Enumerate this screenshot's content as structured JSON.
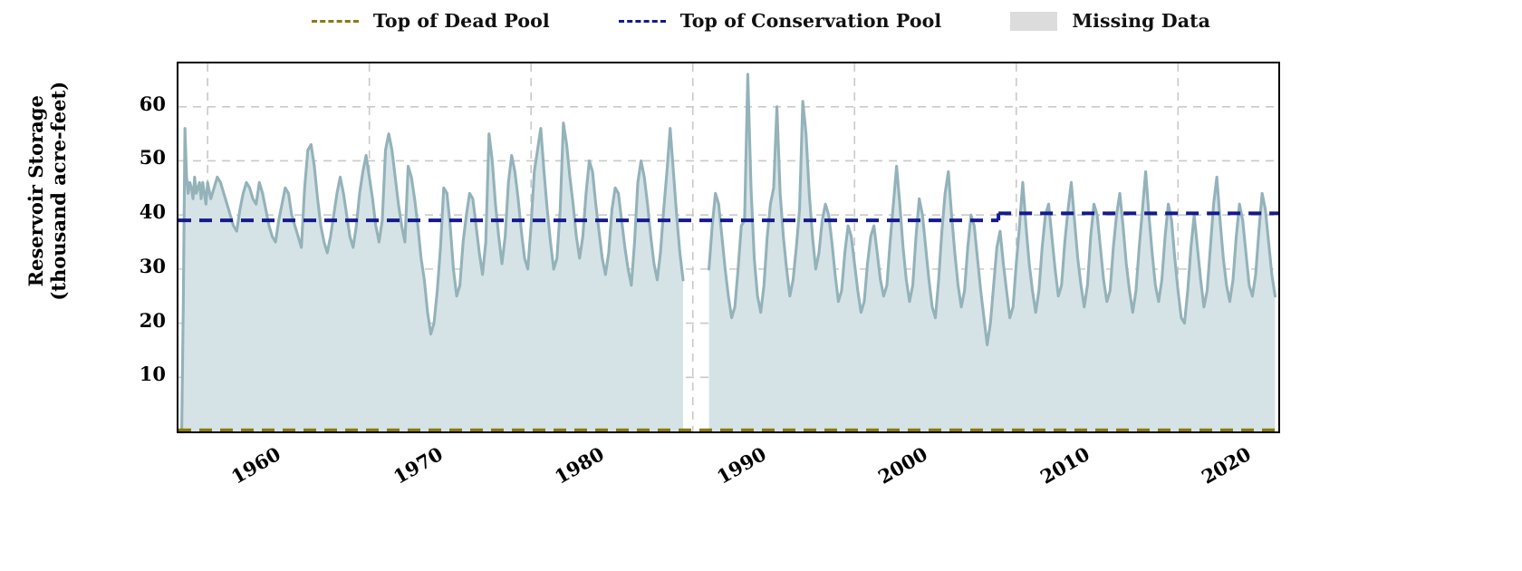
{
  "legend": {
    "entries": [
      {
        "label": "Top of Dead Pool",
        "style": "dashed",
        "color": "#8a7a10"
      },
      {
        "label": "Top of Conservation Pool",
        "style": "dashed",
        "color": "#151a8c"
      },
      {
        "label": "Missing Data",
        "style": "patch",
        "color": "#dcdcdc"
      }
    ]
  },
  "chart_data": {
    "type": "area",
    "title": "",
    "xlabel": "",
    "ylabel": "Reservoir Storage\n(thousand acre-feet)",
    "ylabel_line1": "Reservoir Storage",
    "ylabel_line2": "(thousand acre-feet)",
    "xlim": [
      1958.2,
      2026.2
    ],
    "ylim": [
      0,
      68
    ],
    "yticks": [
      10,
      20,
      30,
      40,
      50,
      60
    ],
    "xticks": [
      1960,
      1970,
      1980,
      1990,
      2000,
      2010,
      2020
    ],
    "grid": true,
    "legend_position": "above-plot-center",
    "colors": {
      "line": "#93b2ba",
      "fill": "#d6e3e6",
      "dead_pool": "#8a7a10",
      "conservation_pool": "#151a8c",
      "missing_data": "#dcdcdc",
      "grid": "#c9c9c9",
      "axis": "#000000"
    },
    "series": [
      {
        "name": "Reservoir Storage",
        "type": "area",
        "units": "thousand acre-feet",
        "x": [
          1958.4,
          1958.5,
          1958.6,
          1958.7,
          1958.8,
          1958.9,
          1959.0,
          1959.1,
          1959.2,
          1959.3,
          1959.4,
          1959.5,
          1959.6,
          1959.7,
          1959.8,
          1959.9,
          1960.0,
          1960.2,
          1960.4,
          1960.6,
          1960.8,
          1961.0,
          1961.2,
          1961.4,
          1961.6,
          1961.8,
          1962.0,
          1962.2,
          1962.4,
          1962.6,
          1962.8,
          1963.0,
          1963.2,
          1963.4,
          1963.6,
          1963.8,
          1964.0,
          1964.2,
          1964.4,
          1964.6,
          1964.8,
          1965.0,
          1965.2,
          1965.4,
          1965.6,
          1965.8,
          1966.0,
          1966.2,
          1966.4,
          1966.6,
          1966.8,
          1967.0,
          1967.2,
          1967.4,
          1967.6,
          1967.8,
          1968.0,
          1968.2,
          1968.4,
          1968.6,
          1968.8,
          1969.0,
          1969.2,
          1969.4,
          1969.6,
          1969.8,
          1970.0,
          1970.2,
          1970.4,
          1970.6,
          1970.8,
          1971.0,
          1971.2,
          1971.4,
          1971.6,
          1971.8,
          1972.0,
          1972.2,
          1972.4,
          1972.6,
          1972.8,
          1973.0,
          1973.2,
          1973.4,
          1973.6,
          1973.8,
          1974.0,
          1974.2,
          1974.4,
          1974.6,
          1974.8,
          1975.0,
          1975.2,
          1975.4,
          1975.6,
          1975.8,
          1976.0,
          1976.2,
          1976.4,
          1976.6,
          1976.8,
          1977.0,
          1977.2,
          1977.4,
          1977.6,
          1977.8,
          1978.0,
          1978.2,
          1978.4,
          1978.6,
          1978.8,
          1979.0,
          1979.2,
          1979.4,
          1979.6,
          1979.8,
          1980.0,
          1980.2,
          1980.4,
          1980.6,
          1980.8,
          1981.0,
          1981.2,
          1981.4,
          1981.6,
          1981.8,
          1982.0,
          1982.2,
          1982.4,
          1982.6,
          1982.8,
          1983.0,
          1983.2,
          1983.4,
          1983.6,
          1983.8,
          1984.0,
          1984.2,
          1984.4,
          1984.6,
          1984.8,
          1985.0,
          1985.2,
          1985.4,
          1985.6,
          1985.8,
          1986.0,
          1986.2,
          1986.4,
          1986.6,
          1986.8,
          1987.0,
          1987.2,
          1987.4,
          1987.6,
          1987.8,
          1988.0,
          1988.2,
          1988.4,
          1988.6,
          1988.8,
          1989.0,
          1989.2,
          1989.4,
          1991.0,
          1991.2,
          1991.4,
          1991.6,
          1991.8,
          1992.0,
          1992.2,
          1992.4,
          1992.6,
          1992.8,
          1993.0,
          1993.2,
          1993.4,
          1993.6,
          1993.8,
          1994.0,
          1994.2,
          1994.4,
          1994.6,
          1994.8,
          1995.0,
          1995.2,
          1995.4,
          1995.6,
          1995.8,
          1996.0,
          1996.2,
          1996.4,
          1996.6,
          1996.8,
          1997.0,
          1997.2,
          1997.4,
          1997.6,
          1997.8,
          1998.0,
          1998.2,
          1998.4,
          1998.6,
          1998.8,
          1999.0,
          1999.2,
          1999.4,
          1999.6,
          1999.8,
          2000.0,
          2000.2,
          2000.4,
          2000.6,
          2000.8,
          2001.0,
          2001.2,
          2001.4,
          2001.6,
          2001.8,
          2002.0,
          2002.2,
          2002.4,
          2002.6,
          2002.8,
          2003.0,
          2003.2,
          2003.4,
          2003.6,
          2003.8,
          2004.0,
          2004.2,
          2004.4,
          2004.6,
          2004.8,
          2005.0,
          2005.2,
          2005.4,
          2005.6,
          2005.8,
          2006.0,
          2006.2,
          2006.4,
          2006.6,
          2006.8,
          2007.0,
          2007.2,
          2007.4,
          2007.6,
          2007.8,
          2008.0,
          2008.2,
          2008.4,
          2008.6,
          2008.8,
          2009.0,
          2009.2,
          2009.4,
          2009.6,
          2009.8,
          2010.0,
          2010.2,
          2010.4,
          2010.6,
          2010.8,
          2011.0,
          2011.2,
          2011.4,
          2011.6,
          2011.8,
          2012.0,
          2012.2,
          2012.4,
          2012.6,
          2012.8,
          2013.0,
          2013.2,
          2013.4,
          2013.6,
          2013.8,
          2014.0,
          2014.2,
          2014.4,
          2014.6,
          2014.8,
          2015.0,
          2015.2,
          2015.4,
          2015.6,
          2015.8,
          2016.0,
          2016.2,
          2016.4,
          2016.6,
          2016.8,
          2017.0,
          2017.2,
          2017.4,
          2017.6,
          2017.8,
          2018.0,
          2018.2,
          2018.4,
          2018.6,
          2018.8,
          2019.0,
          2019.2,
          2019.4,
          2019.6,
          2019.8,
          2020.0,
          2020.2,
          2020.4,
          2020.6,
          2020.8,
          2021.0,
          2021.2,
          2021.4,
          2021.6,
          2021.8,
          2022.0,
          2022.2,
          2022.4,
          2022.6,
          2022.8,
          2023.0,
          2023.2,
          2023.4,
          2023.6,
          2023.8,
          2024.0,
          2024.2,
          2024.4,
          2024.6,
          2024.8,
          2025.0,
          2025.2,
          2025.4,
          2025.6,
          2025.8,
          2026.0
        ],
        "y": [
          0,
          24,
          56,
          47,
          44,
          46,
          45,
          43,
          47,
          44,
          45,
          46,
          43,
          46,
          44,
          42,
          46,
          43,
          45,
          47,
          46,
          44,
          42,
          40,
          38,
          37,
          41,
          44,
          46,
          45,
          43,
          42,
          46,
          44,
          41,
          38,
          36,
          35,
          39,
          42,
          45,
          44,
          40,
          38,
          36,
          34,
          45,
          52,
          53,
          49,
          43,
          38,
          35,
          33,
          36,
          40,
          44,
          47,
          44,
          40,
          36,
          34,
          38,
          44,
          48,
          51,
          47,
          43,
          38,
          35,
          39,
          52,
          55,
          52,
          47,
          42,
          38,
          35,
          49,
          47,
          43,
          38,
          32,
          28,
          22,
          18,
          20,
          26,
          34,
          45,
          44,
          38,
          30,
          25,
          27,
          35,
          40,
          44,
          43,
          38,
          33,
          29,
          35,
          55,
          50,
          42,
          36,
          31,
          36,
          46,
          51,
          48,
          43,
          37,
          32,
          30,
          38,
          48,
          52,
          56,
          48,
          41,
          35,
          30,
          32,
          41,
          57,
          53,
          47,
          42,
          36,
          32,
          36,
          44,
          50,
          48,
          42,
          37,
          32,
          29,
          33,
          41,
          45,
          44,
          39,
          34,
          30,
          27,
          35,
          46,
          50,
          47,
          42,
          36,
          31,
          28,
          33,
          41,
          48,
          56,
          48,
          40,
          33,
          28,
          30,
          38,
          44,
          42,
          36,
          30,
          25,
          21,
          23,
          30,
          38,
          39,
          66,
          45,
          32,
          25,
          22,
          27,
          36,
          42,
          45,
          60,
          44,
          36,
          30,
          25,
          28,
          34,
          41,
          61,
          55,
          44,
          36,
          30,
          33,
          39,
          42,
          40,
          35,
          29,
          24,
          26,
          33,
          38,
          36,
          31,
          26,
          22,
          24,
          31,
          36,
          38,
          33,
          28,
          25,
          27,
          35,
          42,
          49,
          42,
          34,
          28,
          24,
          27,
          36,
          43,
          40,
          34,
          28,
          23,
          21,
          28,
          37,
          44,
          48,
          40,
          33,
          27,
          23,
          26,
          34,
          40,
          38,
          32,
          26,
          21,
          16,
          20,
          27,
          34,
          37,
          31,
          26,
          21,
          23,
          31,
          38,
          46,
          38,
          31,
          26,
          22,
          26,
          34,
          40,
          42,
          36,
          30,
          25,
          27,
          35,
          41,
          46,
          39,
          32,
          27,
          23,
          27,
          36,
          42,
          40,
          34,
          28,
          24,
          26,
          34,
          40,
          44,
          38,
          31,
          26,
          22,
          26,
          34,
          41,
          48,
          40,
          33,
          27,
          24,
          28,
          36,
          42,
          39,
          32,
          26,
          21,
          20,
          26,
          34,
          40,
          34,
          28,
          23,
          26,
          34,
          42,
          47,
          39,
          32,
          27,
          24,
          28,
          36,
          42,
          39,
          33,
          27,
          25,
          29,
          37,
          44,
          41,
          35,
          29,
          25,
          28,
          36,
          43,
          40,
          35,
          29,
          25,
          22,
          29,
          37,
          45,
          51,
          43,
          36,
          30,
          26,
          29,
          37,
          44,
          41,
          35,
          29,
          25,
          28,
          36,
          43,
          40,
          34,
          28,
          25,
          28,
          36,
          42,
          39,
          34,
          30,
          27,
          31,
          39,
          45,
          43,
          37,
          31,
          27,
          30,
          38,
          44,
          41,
          35,
          30,
          26,
          29,
          37,
          43,
          40,
          34,
          29,
          25,
          28,
          36,
          41,
          38,
          33,
          28,
          24,
          27,
          35,
          41,
          39,
          34,
          29,
          26,
          30,
          38,
          44,
          42,
          36,
          30,
          27,
          31,
          38,
          45,
          43,
          37,
          32,
          28,
          31,
          39,
          46,
          43,
          38,
          33,
          29,
          32,
          40,
          47,
          44,
          39,
          34,
          30,
          33,
          41,
          48,
          45,
          40,
          35,
          31,
          34,
          42,
          49,
          46,
          41,
          36,
          32,
          35,
          42,
          48,
          45,
          40,
          35,
          31,
          34,
          41,
          47,
          44,
          39,
          34,
          30,
          33,
          40,
          46,
          43,
          38,
          34,
          30,
          33,
          40,
          45,
          42,
          38,
          34,
          31,
          34,
          41,
          47,
          44,
          40,
          36,
          33,
          36,
          43,
          49,
          46,
          42,
          38,
          35,
          38,
          44,
          50,
          47,
          43,
          39,
          36,
          39,
          45,
          51,
          48,
          44,
          40,
          37,
          40,
          46,
          52,
          49,
          45,
          41,
          38,
          41,
          47,
          53,
          50,
          46,
          42,
          39,
          42
        ]
      }
    ],
    "reference_lines": [
      {
        "name": "Top of Conservation Pool",
        "color": "#151a8c",
        "style": "dashed",
        "segments": [
          {
            "x_start": 1958.2,
            "x_end": 2008.9,
            "y": 39.0
          },
          {
            "x_start": 2008.9,
            "x_end": 2026.2,
            "y": 40.3
          }
        ]
      },
      {
        "name": "Top of Dead Pool",
        "color": "#8a7a10",
        "style": "dashed",
        "segments": [
          {
            "x_start": 1958.2,
            "x_end": 2026.2,
            "y": 0.2
          }
        ]
      }
    ],
    "missing_data_spans": [
      {
        "x_start": 1989.45,
        "x_end": 1990.95
      }
    ]
  }
}
